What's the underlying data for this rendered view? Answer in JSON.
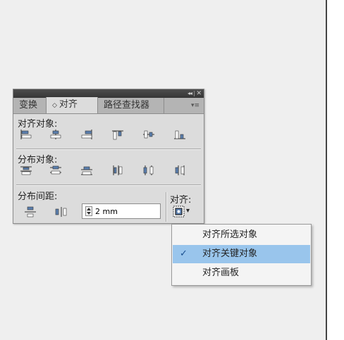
{
  "panel": {
    "titlebar": {
      "collapse_glyph": "◂◂",
      "close_glyph": "✕"
    },
    "tabs": [
      {
        "label": "变换"
      },
      {
        "label": "对齐",
        "arrow": "◇",
        "active": true
      },
      {
        "label": "路径查找器"
      }
    ],
    "tab_menu_glyph": "▾≡",
    "sections": {
      "align_objects": {
        "label": "对齐对象:"
      },
      "distribute_objects": {
        "label": "分布对象:"
      },
      "distribute_spacing": {
        "label": "分布间距:"
      }
    },
    "spacing_value": "2 mm",
    "align_to_label": "对齐:",
    "align_to_dropdown_glyph": "▾"
  },
  "menu": {
    "items": [
      {
        "label": "对齐所选对象",
        "selected": false
      },
      {
        "label": "对齐关键对象",
        "selected": true,
        "check": "✓"
      },
      {
        "label": "对齐画板",
        "selected": false
      }
    ]
  },
  "colors": {
    "panel_bg": "#dcdcdc",
    "tabbar_bg": "#b4b4b4",
    "titlebar_bg": "#3d3d3d",
    "menu_highlight": "#99c5ec",
    "icon_blue": "#5b7fae"
  }
}
